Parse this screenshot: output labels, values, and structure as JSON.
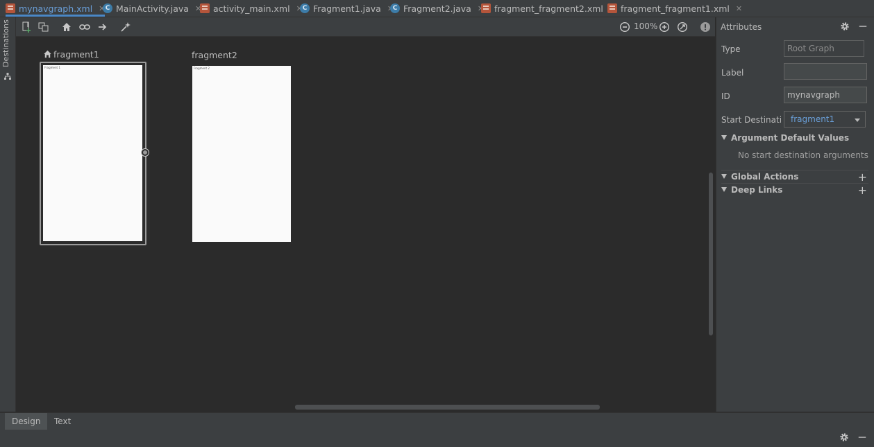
{
  "tabs": [
    {
      "label": "mynavgraph.xml",
      "kind": "xml",
      "active": true
    },
    {
      "label": "MainActivity.java",
      "kind": "java",
      "active": false
    },
    {
      "label": "activity_main.xml",
      "kind": "xml",
      "active": false
    },
    {
      "label": "Fragment1.java",
      "kind": "java",
      "active": false
    },
    {
      "label": "Fragment2.java",
      "kind": "java",
      "active": false
    },
    {
      "label": "fragment_fragment2.xml",
      "kind": "xml",
      "active": false
    },
    {
      "label": "fragment_fragment1.xml",
      "kind": "xml",
      "active": false
    }
  ],
  "sidebar": {
    "destinations_label": "Destinations"
  },
  "toolbar": {
    "zoom": "100%"
  },
  "canvas": {
    "destinations": [
      {
        "title": "fragment1",
        "is_start": true,
        "selected": true,
        "preview_text": "Fragment 1"
      },
      {
        "title": "fragment2",
        "is_start": false,
        "selected": false,
        "preview_text": "Fragment 2"
      }
    ]
  },
  "attributes": {
    "header": "Attributes",
    "type_label": "Type",
    "type_value": "Root Graph",
    "label_label": "Label",
    "label_value": "",
    "id_label": "ID",
    "id_value": "mynavgraph",
    "start_label": "Start Destination",
    "start_value": "fragment1",
    "arg_section": "Argument Default Values",
    "arg_empty": "No start destination arguments",
    "global_actions": "Global Actions",
    "deep_links": "Deep Links"
  },
  "bottom_tabs": [
    {
      "label": "Design",
      "active": true
    },
    {
      "label": "Text",
      "active": false
    }
  ],
  "colors": {
    "accent": "#4a88c7",
    "link": "#6a9fd8",
    "bg": "#2b2b2b",
    "panel": "#3c3f41"
  }
}
